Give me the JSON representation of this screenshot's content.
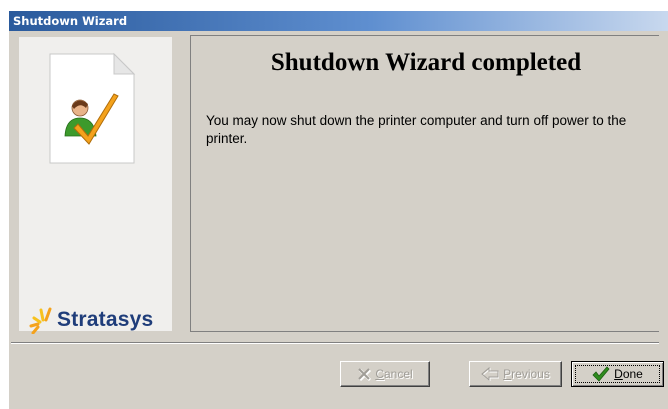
{
  "window": {
    "title": "Shutdown Wizard"
  },
  "side": {
    "brand": "Stratasys"
  },
  "content": {
    "heading": "Shutdown Wizard completed",
    "message": "You may now shut down the printer computer and turn off power to the printer."
  },
  "buttons": {
    "cancel": {
      "mnemonic": "C",
      "rest": "ancel",
      "icon": "cancel-x-icon"
    },
    "previous": {
      "mnemonic": "P",
      "rest": "revious",
      "icon": "back-arrow-icon"
    },
    "done": {
      "mnemonic": "D",
      "rest": "one",
      "icon": "green-check-icon"
    }
  },
  "colors": {
    "accent_green": "#2e8b1e",
    "brand_blue": "#1f3d7a",
    "brand_orange": "#f4a21c"
  }
}
